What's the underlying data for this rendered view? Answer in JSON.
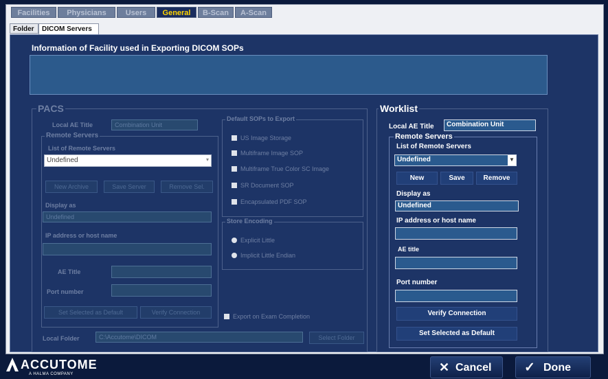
{
  "tabs": [
    {
      "label": "Facilities",
      "active": false
    },
    {
      "label": "Physicians",
      "active": false
    },
    {
      "label": "Users",
      "active": false
    },
    {
      "label": "General",
      "active": true
    },
    {
      "label": "B-Scan",
      "active": false
    },
    {
      "label": "A-Scan",
      "active": false
    }
  ],
  "subtabs": [
    {
      "label": "Folder",
      "active": false
    },
    {
      "label": "DICOM Servers",
      "active": true
    }
  ],
  "info_heading": "Information of Facility used in Exporting DICOM SOPs",
  "pacs": {
    "legend": "PACS",
    "local_ae_title_label": "Local AE Title",
    "local_ae_title_value": "Combination Unit",
    "remote_servers_legend": "Remote Servers",
    "list_label": "List of Remote Servers",
    "list_value": "Undefined",
    "buttons": {
      "new": "New Archive",
      "save": "Save Server",
      "remove": "Remove Sel."
    },
    "display_as_label": "Display as",
    "display_as_value": "Undefined",
    "ip_label": "IP address or host name",
    "ae_title_label": "AE Title",
    "port_label": "Port number",
    "set_default": "Set Selected as Default",
    "verify": "Verify Connection",
    "sop_legend": "Default SOPs to Export",
    "sop_options": [
      "US Image Storage",
      "Multiframe Image SOP",
      "Multiframe True Color SC Image",
      "SR Document SOP",
      "Encapsulated PDF SOP"
    ],
    "sr_legend": "Store Encoding",
    "radio_options": [
      "Explicit Little",
      "Implicit Little Endian"
    ],
    "export_check": "Export on Exam Completion",
    "local_folder_label": "Local Folder",
    "local_folder_value": "C:\\Accutome\\DICOM",
    "select_folder": "Select Folder"
  },
  "worklist": {
    "legend": "Worklist",
    "local_ae_title_label": "Local AE Title",
    "local_ae_title_value": "Combination Unit",
    "remote_servers_legend": "Remote Servers",
    "list_label": "List of Remote Servers",
    "list_value": "Undefined",
    "new_button": "New",
    "save_button": "Save",
    "remove_button": "Remove",
    "display_as_label": "Display as",
    "display_as_value": "Undefined",
    "ip_label": "IP address or host name",
    "ip_value": "",
    "ae_title_label": "AE title",
    "ae_title_value": "",
    "port_label": "Port number",
    "port_value": "",
    "verify_button": "Verify Connection",
    "set_default_button": "Set Selected as Default"
  },
  "footer": {
    "logo_text": "ACCUTOME",
    "logo_sub": "A HALMA COMPANY",
    "cancel_label": "Cancel",
    "done_label": "Done"
  }
}
